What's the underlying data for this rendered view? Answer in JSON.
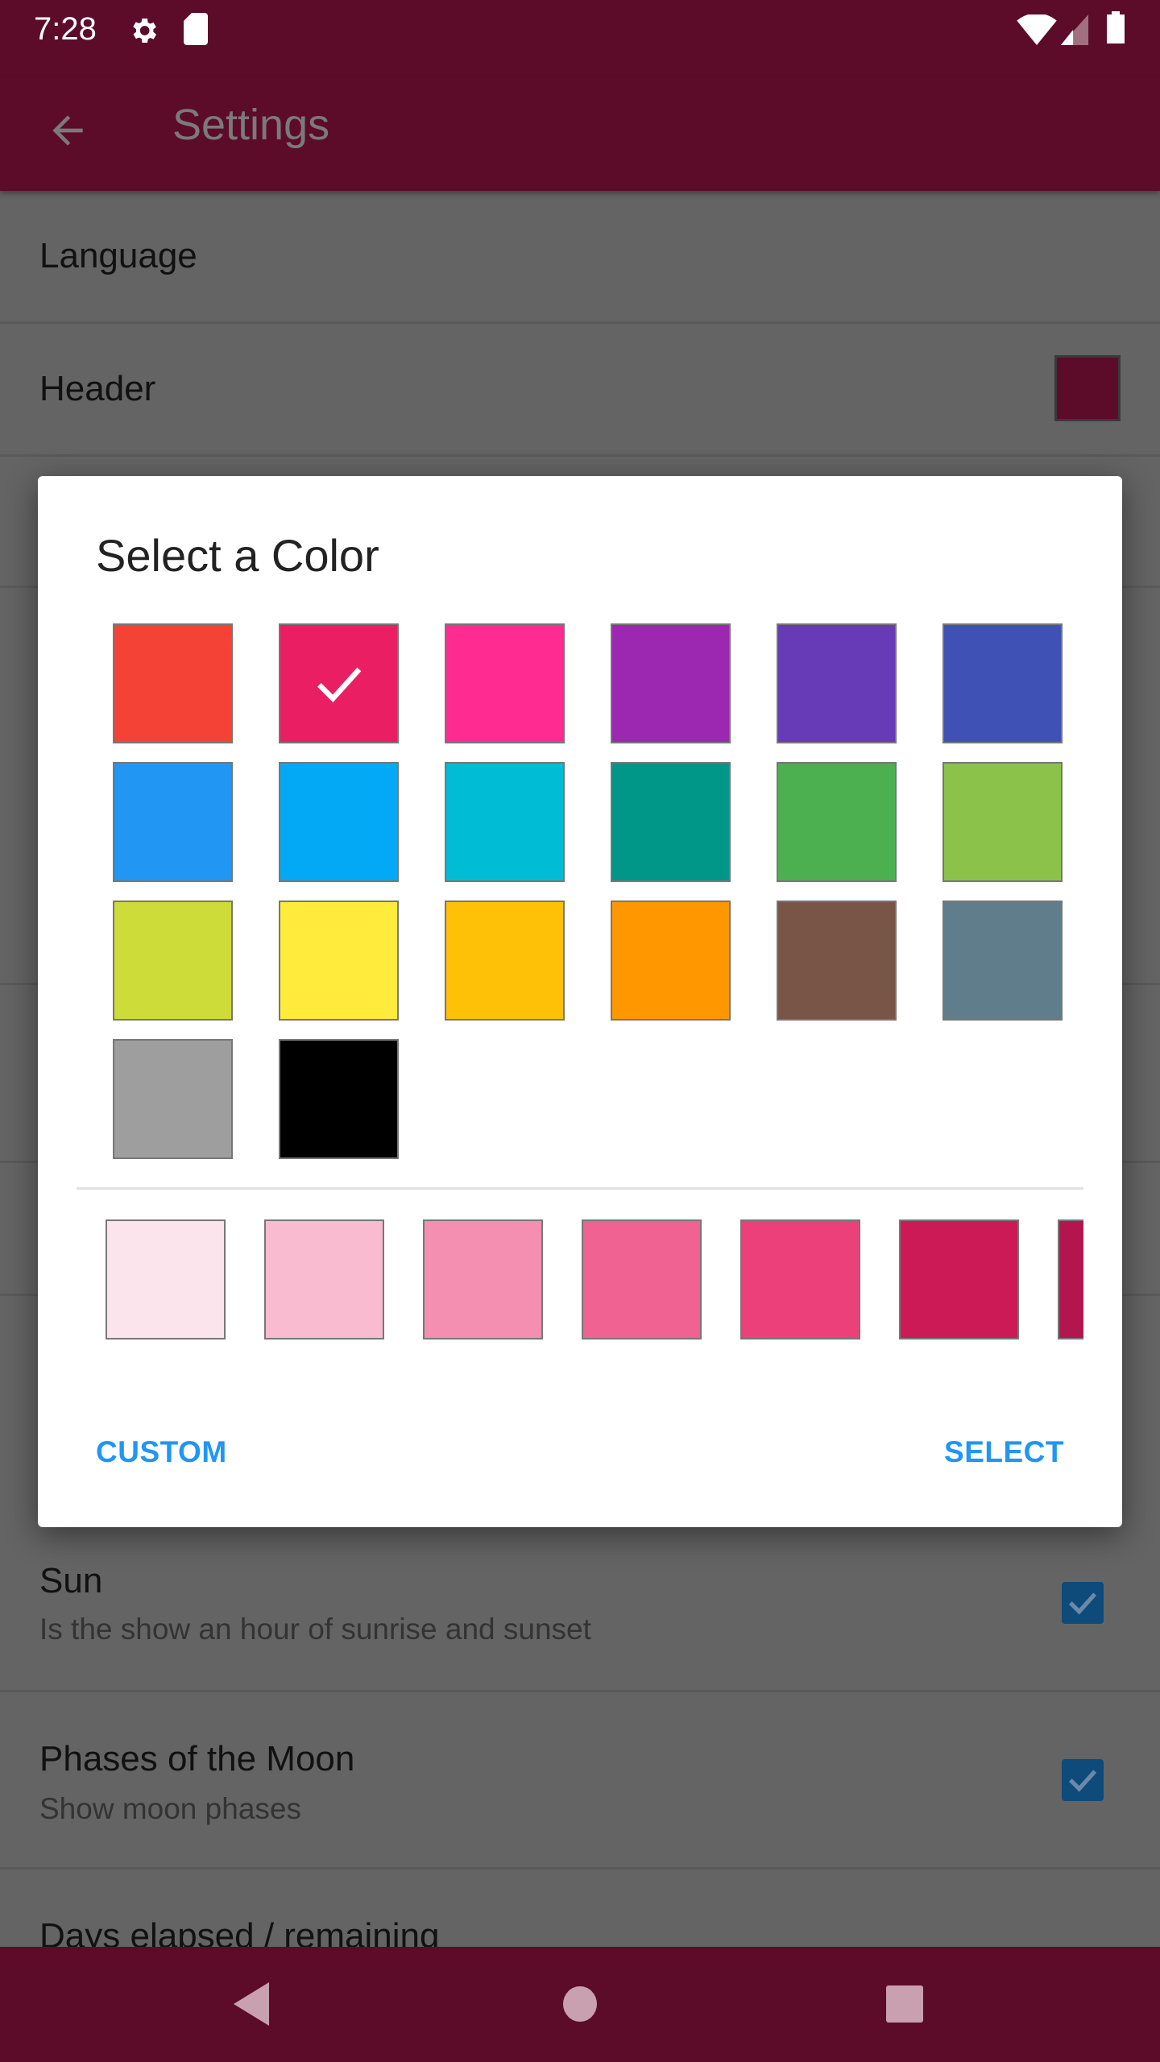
{
  "status_bar": {
    "time": "7:28",
    "icons": [
      "gear-icon",
      "sd-card-icon",
      "wifi-icon",
      "signal-icon",
      "battery-icon"
    ]
  },
  "app_bar": {
    "title": "Settings",
    "back_icon": "arrow-left-icon",
    "color": "#5c0c28"
  },
  "settings": {
    "language": {
      "title": "Language"
    },
    "header": {
      "title": "Header",
      "swatch_color": "#5c0c28"
    },
    "sun": {
      "title": "Sun",
      "subtitle": "Is the show an hour of sunrise and sunset",
      "checked": true
    },
    "moon": {
      "title": "Phases of the Moon",
      "subtitle": "Show moon phases",
      "checked": true
    },
    "days": {
      "title": "Days elapsed / remaining"
    }
  },
  "dialog": {
    "title": "Select a Color",
    "colors": [
      "#F44336",
      "#E91E63",
      "#FF2B91",
      "#9C27B0",
      "#673AB7",
      "#3F51B5",
      "#2196F3",
      "#03A9F4",
      "#00BCD4",
      "#009688",
      "#4CAF50",
      "#8BC34A",
      "#CDDC39",
      "#FFEB3B",
      "#FFC107",
      "#FF9800",
      "#795548",
      "#607D8B",
      "#9E9E9E",
      "#000000"
    ],
    "selected_index": 1,
    "shades": [
      "#FCE4EC",
      "#F8BBD0",
      "#F48FB1",
      "#F06292",
      "#EC407A",
      "#CB1A55",
      "#B3164E"
    ],
    "custom_label": "CUSTOM",
    "select_label": "SELECT",
    "accent": "#2196F3"
  },
  "nav_bar": {
    "icons": [
      "back-triangle-icon",
      "home-circle-icon",
      "recents-square-icon"
    ]
  }
}
